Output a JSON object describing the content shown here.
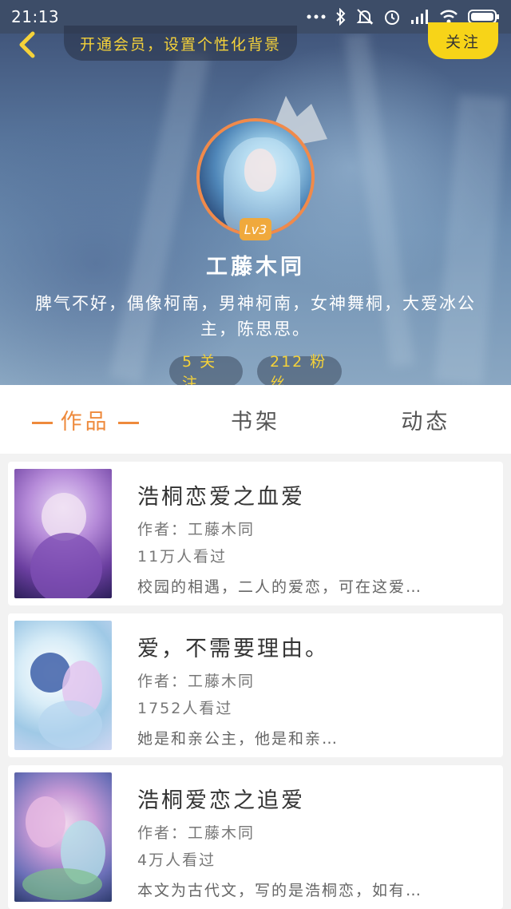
{
  "status_bar": {
    "time": "21:13",
    "icons": [
      "more-dots-icon",
      "bluetooth-icon",
      "mute-icon",
      "alarm-icon",
      "signal-icon",
      "wifi-icon",
      "battery-icon"
    ]
  },
  "header": {
    "vip_prompt": "开通会员，设置个性化背景",
    "follow_label": "关注"
  },
  "profile": {
    "level": "Lv3",
    "name": "工藤木同",
    "bio": "脾气不好，偶像柯南，男神柯南，女神舞桐，大爱冰公主，陈思思。",
    "following": "5 关注",
    "followers": "212 粉丝"
  },
  "tabs": [
    {
      "label": "作品",
      "active": true
    },
    {
      "label": "书架",
      "active": false
    },
    {
      "label": "动态",
      "active": false
    }
  ],
  "works": [
    {
      "title": "浩桐恋爱之血爱",
      "author": "作者：工藤木同",
      "views": "11万人看过",
      "description": "校园的相遇，二人的爱恋，可在这爱…"
    },
    {
      "title": "爱，不需要理由。",
      "author": "作者：工藤木同",
      "views": "1752人看过",
      "description": "她是和亲公主，他是和亲…"
    },
    {
      "title": "浩桐爱恋之追爱",
      "author": "作者：工藤木同",
      "views": "4万人看过",
      "description": "本文为古代文，写的是浩桐恋，如有…"
    }
  ],
  "colors": {
    "accent": "#ee8a3c",
    "vip_text": "#f5d23a",
    "follow_button": "#f7d418",
    "avatar_border": "#f08a4b",
    "level_badge": "#f0a93c"
  }
}
